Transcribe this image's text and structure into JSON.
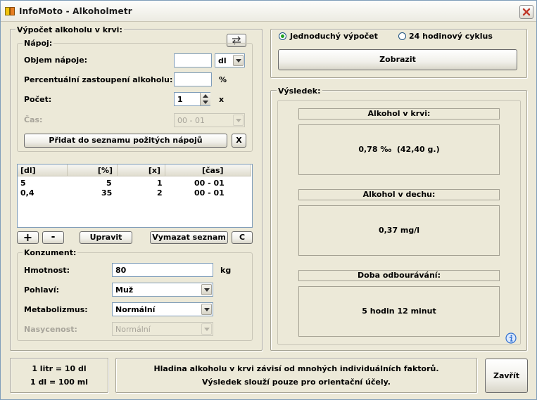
{
  "window": {
    "title": "InfoMoto - Alkoholmetr",
    "colors": {
      "accent": "#21a121",
      "close_icon": "#c0392b",
      "info_icon": "#2f6fd0"
    }
  },
  "calc": {
    "group_title": "Výpočet alkoholu v krvi:",
    "drink": {
      "group_title": "Nápoj:",
      "volume_label": "Objem nápoje:",
      "volume_value": "",
      "volume_unit": "dl",
      "percent_label": "Percentuální zastoupení alkoholu:",
      "percent_value": "",
      "percent_unit": "%",
      "count_label": "Počet:",
      "count_value": "1",
      "count_unit": "x",
      "time_label": "Čas:",
      "time_value": "00 - 01",
      "add_button": "Přidat do seznamu požitých nápojů",
      "clear_input_button": "X"
    },
    "list": {
      "columns": [
        "[dl]",
        "[%]",
        "[x]",
        "[čas]"
      ],
      "rows": [
        [
          "5",
          "5",
          "1",
          "00 - 01"
        ],
        [
          "0,4",
          "35",
          "2",
          "00 - 01"
        ]
      ]
    },
    "list_buttons": {
      "add": "+",
      "remove": "-",
      "edit": "Upravit",
      "clear": "Vymazat seznam",
      "c": "C"
    },
    "consumer": {
      "group_title": "Konzument:",
      "weight_label": "Hmotnost:",
      "weight_value": "80",
      "weight_unit": "kg",
      "sex_label": "Pohlaví:",
      "sex_value": "Muž",
      "metabolism_label": "Metabolizmus:",
      "metabolism_value": "Normální",
      "satiety_label": "Nasycenost:",
      "satiety_value": "Normální"
    }
  },
  "mode": {
    "simple": "Jednoduchý výpočet",
    "cycle": "24 hodinový cyklus",
    "show_button": "Zobrazit"
  },
  "result": {
    "group_title": "Výsledek:",
    "blood_title": "Alkohol v krvi:",
    "blood_value": "0,78 ‰  (42,40 g.)",
    "breath_title": "Alkohol v dechu:",
    "breath_value": "0,37 mg/l",
    "time_title": "Doba odbourávání:",
    "time_value": "5 hodin 12 minut"
  },
  "footer": {
    "conv1": "1 litr = 10 dl",
    "conv2": "1 dl = 100 ml",
    "note1": "Hladina alkoholu v krvi závisí od mnohých individuálních faktorů.",
    "note2": "Výsledek slouží pouze pro orientační účely.",
    "close_button": "Zavřít"
  }
}
